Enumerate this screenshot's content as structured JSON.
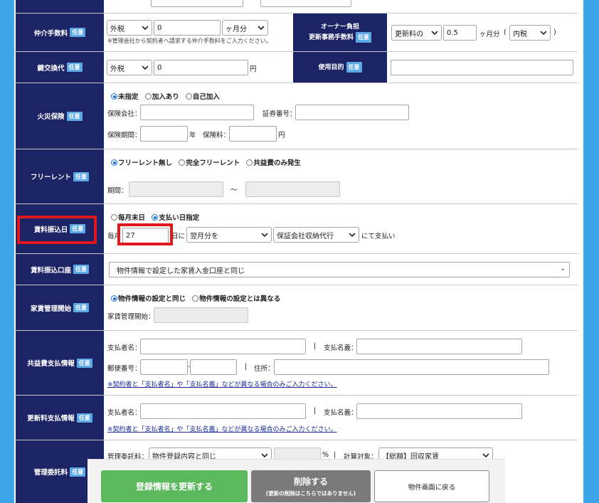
{
  "badge_optional": "任意",
  "rows": {
    "brokerage": {
      "label": "仲介手数料",
      "tax_select": "外税",
      "amount": "0",
      "unit_select": "ヶ月分",
      "note": "※管理会社から契約者へ請求する仲介手数料をご入力ください。"
    },
    "owner_fee": {
      "label_line1": "オーナー負担",
      "label_line2": "更新事務手数料",
      "basis_select": "更新料の",
      "value": "0.5",
      "unit_text": "ヶ月分",
      "paren_open": "(",
      "tax_select": "内税",
      "paren_close": ")"
    },
    "key_exchange": {
      "label": "鍵交換代",
      "tax_select": "外税",
      "amount": "0",
      "unit": "円"
    },
    "usage": {
      "label": "使用目的",
      "value": ""
    },
    "fire_insurance": {
      "label": "火災保険",
      "options": [
        "未指定",
        "加入あり",
        "自己加入"
      ],
      "selected": 0,
      "company_label": "保険会社：",
      "cert_label": "証券番号：",
      "period_label": "保険期間：",
      "year_unit": "年",
      "premium_label": "保険料：",
      "yen_unit": "円"
    },
    "free_rent": {
      "label": "フリーレント",
      "options": [
        "フリーレント無し",
        "完全フリーレント",
        "共益費のみ発生"
      ],
      "selected": 0,
      "period_label": "期間：",
      "tilde": "〜"
    },
    "rent_transfer_day": {
      "label": "賃料振込日",
      "options": [
        "毎月末日",
        "支払い日指定"
      ],
      "selected": 1,
      "prefix": "毎月",
      "day": "27",
      "day_suffix": "日に",
      "month_select": "翌月分を",
      "method_select": "保証会社収納代行",
      "suffix": "にて支払い"
    },
    "rent_account": {
      "label": "賃料振込口座",
      "select": "物件情報で設定した家賃入金口座と同じ"
    },
    "rent_mgmt_start": {
      "label": "家賃管理開始",
      "options": [
        "物件情報の設定と同じ",
        "物件情報の設定とは異なる"
      ],
      "selected": 0,
      "start_label": "家賃管理開始："
    },
    "common_fee_payment": {
      "label": "共益費支払情報",
      "payer_label": "支払者名：",
      "sep": "|",
      "payee_label": "支払名義：",
      "postal_label": "郵便番号：",
      "dash": "-",
      "address_label": "住所：",
      "note": "※契約者と「支払者名」や「支払名義」などが異なる場合のみご入力ください。"
    },
    "renewal_fee_payment": {
      "label": "更新料支払情報",
      "payer_label": "支払者名：",
      "sep": "|",
      "payee_label": "支払名義：",
      "note": "※契約者と「支払者名」や「支払名義」などが異なる場合のみご入力ください。"
    },
    "mgmt_fee": {
      "label": "管理委託料",
      "fee_label": "管理委託料：",
      "fee_select": "物件登録内容と同じ",
      "pct": "%",
      "sep": "|",
      "calc_label": "計算対象：",
      "calc_select": "【総額】回収家賃"
    }
  },
  "buttons": {
    "update": "登録情報を更新する",
    "delete": "削除する",
    "delete_note": "(更新の削除はこちらではありません)",
    "back": "物件画面に戻る"
  },
  "colors": {
    "label_bg": "#1d2466",
    "badge_bg": "#5aa9e6",
    "highlight": "#e0181e",
    "update_btn": "#5cb85c",
    "delete_btn": "#7a7a7a",
    "frame": "#3da6e8"
  }
}
